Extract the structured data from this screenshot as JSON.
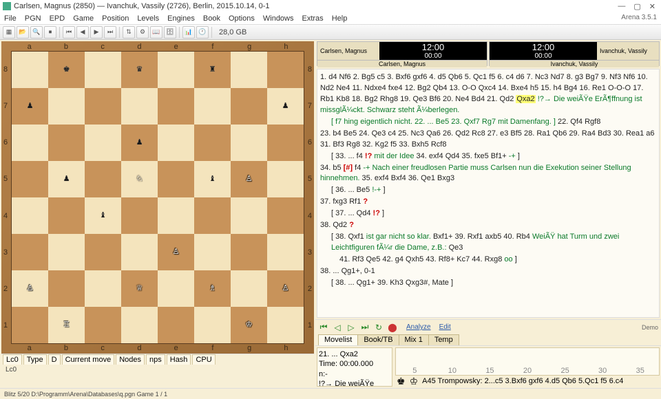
{
  "title": "Carlsen, Magnus (2850) — Ivanchuk, Vassily (2726),  Berlin,  2015.10.14,  0-1",
  "app_version": "Arena 3.5.1",
  "menu": [
    "File",
    "PGN",
    "EPD",
    "Game",
    "Position",
    "Levels",
    "Engines",
    "Book",
    "Options",
    "Windows",
    "Extras",
    "Help"
  ],
  "toolbar_label": "28,0 GB",
  "files": [
    "a",
    "b",
    "c",
    "d",
    "e",
    "f",
    "g",
    "h"
  ],
  "ranks": [
    "8",
    "7",
    "6",
    "5",
    "4",
    "3",
    "2",
    "1"
  ],
  "board": [
    [
      "",
      "bk",
      "",
      "bq",
      "",
      "br",
      "",
      ""
    ],
    [
      "bp",
      "",
      "",
      "",
      "",
      "",
      "",
      "bp"
    ],
    [
      "",
      "",
      "",
      "bp",
      "",
      "",
      "",
      ""
    ],
    [
      "",
      "bp",
      "",
      "wn",
      "",
      "bb",
      "wp",
      ""
    ],
    [
      "",
      "",
      "bb",
      "",
      "",
      "",
      "",
      ""
    ],
    [
      "",
      "",
      "",
      "",
      "wp",
      "",
      "",
      ""
    ],
    [
      "wp",
      "",
      "",
      "wq",
      "",
      "wb",
      "",
      "wp"
    ],
    [
      "",
      "wr",
      "",
      "",
      "",
      "",
      "wk",
      ""
    ]
  ],
  "clocks": {
    "white": {
      "name": "Carlsen, Magnus",
      "t1": "12:00",
      "t2": "00:00",
      "label": "Carlsen, Magnus"
    },
    "black": {
      "name": "Ivanchuk, Vassily",
      "t1": "12:00",
      "t2": "00:00",
      "label": "Ivanchuk, Vassily"
    }
  },
  "moves": [
    {
      "t": "plain",
      "x": "1. d4 Nf6 2. Bg5 c5 3. Bxf6 gxf6 4. d5 Qb6 5. Qc1 f5 6. c4 d6 7. Nc3 Nd7 8. g3 Bg7 9. Nf3 Nf6 10. Nd2 Ne4 11. Ndxe4 fxe4 12. Bg2 Qb4 13. O-O Qxc4 14. Bxe4 h5 15. h4 Bg4 16. Re1 O-O-O 17. Rb1 Kb8 18. Bg2 Rhg8 19. Qe3 Bf6 20. Ne4 Bd4 21. Qd2 "
    },
    {
      "t": "hl",
      "x": "Qxa2"
    },
    {
      "t": "green",
      "x": " !?→ Die weiÃŸe ErÃ¶ffnung ist missglÃ¼ckt. Schwarz steht Ã¼berlegen."
    },
    {
      "t": "br"
    },
    {
      "t": "indent-green",
      "x": "[ f7 hing eigentlich nicht. 22. ... Be5 23. Qxf7 Rg7 mit Damenfang. ]"
    },
    {
      "t": "plain2",
      "x": " 22. Qf4 Rgf8"
    },
    {
      "t": "br"
    },
    {
      "t": "plain",
      "x": "23. b4 Be5 24. Qe3 c4 25. Nc3 Qa6 26. Qd2 Rc8 27. e3 Bf5 28. Ra1 Qb6 29. Ra4 Bd3 30. Rea1 a6 31. Bf3 Rg8 32. Kg2 f5 33. Bxh5 Rcf8"
    },
    {
      "t": "br"
    },
    {
      "t": "indent",
      "x": "[ 33. ... f4 "
    },
    {
      "t": "sym",
      "x": "!?"
    },
    {
      "t": "green",
      "x": " mit der Idee"
    },
    {
      "t": "plain2",
      "x": " 34. exf4 Qd4 35. fxe5 Bf1+ "
    },
    {
      "t": "green",
      "x": "-+"
    },
    {
      "t": "plain2",
      "x": " ]"
    },
    {
      "t": "br"
    },
    {
      "t": "plain",
      "x": "34. b5 "
    },
    {
      "t": "sym",
      "x": "[#]"
    },
    {
      "t": "plain2",
      "x": " f4 "
    },
    {
      "t": "green",
      "x": "-+ Nach einer freudlosen Partie muss Carlsen nun die Exekution seiner Stellung hinnehmen."
    },
    {
      "t": "plain2",
      "x": " 35. exf4 Bxf4 36. Qe1 Bxg3"
    },
    {
      "t": "br"
    },
    {
      "t": "indent",
      "x": "[ 36. ... Be5 "
    },
    {
      "t": "green",
      "x": "!-+"
    },
    {
      "t": "plain2",
      "x": " ]"
    },
    {
      "t": "br"
    },
    {
      "t": "plain",
      "x": "37. fxg3 Rf1 "
    },
    {
      "t": "sym",
      "x": "?"
    },
    {
      "t": "br"
    },
    {
      "t": "indent",
      "x": "[ 37. ... Qd4 "
    },
    {
      "t": "sym",
      "x": "!?"
    },
    {
      "t": "plain2",
      "x": " ]"
    },
    {
      "t": "br"
    },
    {
      "t": "plain",
      "x": "38. Qd2 "
    },
    {
      "t": "sym",
      "x": "?"
    },
    {
      "t": "br"
    },
    {
      "t": "indent",
      "x": "[ 38. Qxf1 "
    },
    {
      "t": "green",
      "x": "ist gar nicht so klar."
    },
    {
      "t": "plain2",
      "x": " Bxf1+ 39. Rxf1 axb5 40. Rb4 "
    },
    {
      "t": "green",
      "x": "WeiÃŸ hat Turm und zwei Leichtfiguren fÃ¼r die Dame, z.B.:"
    },
    {
      "t": "plain2",
      "x": " Qe3"
    },
    {
      "t": "br"
    },
    {
      "t": "indent2",
      "x": "41. Rf3 Qe5 42. g4 Qxh5 43. Rf8+ Kc7 44. Rxg8 "
    },
    {
      "t": "green",
      "x": "oo"
    },
    {
      "t": "plain2",
      "x": " ]"
    },
    {
      "t": "br"
    },
    {
      "t": "plain",
      "x": "38. ... Qg1+, 0-1"
    },
    {
      "t": "br"
    },
    {
      "t": "indent",
      "x": "[ 38. ... Qg1+ 39. Kh3 Qxg3#, Mate ]"
    }
  ],
  "eng_headers": [
    "Lc0",
    "Type",
    "D",
    "Current move",
    "Nodes",
    "nps",
    "Hash",
    "CPU"
  ],
  "eng_name": "Lc0",
  "ctrl_links": [
    "Analyze",
    "Edit"
  ],
  "demo_label": "Demo",
  "tabs": [
    "Movelist",
    "Book/TB",
    "Mix 1",
    "Temp"
  ],
  "info": {
    "move": "21. ... Qxa2",
    "time": "Time: 00:00.000",
    "nodes": "n:-",
    "comment": "!?→ Die weiÃŸe"
  },
  "timeline_ticks": [
    "5",
    "10",
    "15",
    "20",
    "25",
    "30",
    "35"
  ],
  "opening": "A45  Trompowsky: 2...c5 3.Bxf6 gxf6 4.d5 Qb6 5.Qc1 f5 6.c4",
  "status": "Blitz 5/20   D:\\Programm\\Arena\\Databases\\q.pgn  Game 1 / 1"
}
